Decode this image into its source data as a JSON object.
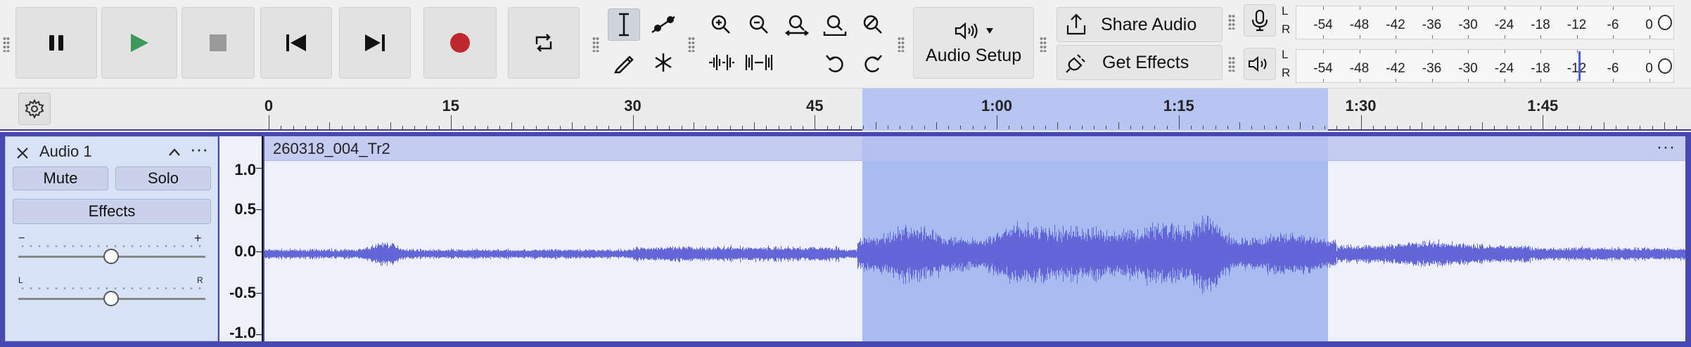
{
  "transport": {
    "pause": "Pause",
    "play": "Play",
    "stop": "Stop",
    "skip_start": "Skip to Start",
    "skip_end": "Skip to End",
    "record": "Record",
    "loop": "Loop",
    "colors": {
      "play": "#3b9a5a",
      "record": "#c0282d",
      "stop": "#9a9a9a"
    }
  },
  "tools": [
    "selection-tool",
    "envelope-tool",
    "draw-tool",
    "multi-tool"
  ],
  "zoom": [
    "zoom-in",
    "zoom-out",
    "fit-selection",
    "fit-project",
    "zoom-toggle",
    "trim-outside",
    "silence-selection",
    "undo",
    "redo"
  ],
  "audio_setup": {
    "label": "Audio Setup"
  },
  "share_audio": {
    "label": "Share Audio"
  },
  "get_effects": {
    "label": "Get Effects"
  },
  "meters": {
    "channel_l": "L",
    "channel_r": "R",
    "ticks": [
      "-54",
      "-48",
      "-42",
      "-36",
      "-30",
      "-24",
      "-18",
      "-12",
      "-6",
      "0"
    ],
    "playback_level_db": -12
  },
  "timeline": {
    "labels": [
      "0",
      "15",
      "30",
      "45",
      "1:00",
      "1:15",
      "1:30",
      "1:45"
    ],
    "selection_start_s": 48.9,
    "selection_end_s": 87.3
  },
  "track": {
    "name": "Audio 1",
    "mute_label": "Mute",
    "solo_label": "Solo",
    "effects_label": "Effects",
    "gain_minus": "−",
    "gain_plus": "+",
    "pan_left": "L",
    "pan_right": "R",
    "more": "···"
  },
  "clip": {
    "name": "260318_004_Tr2",
    "more": "···",
    "wave_color": "#6266d6"
  },
  "amplitude_labels": [
    "1.0",
    "0.5",
    "0.0",
    "-0.5",
    "-1.0"
  ]
}
